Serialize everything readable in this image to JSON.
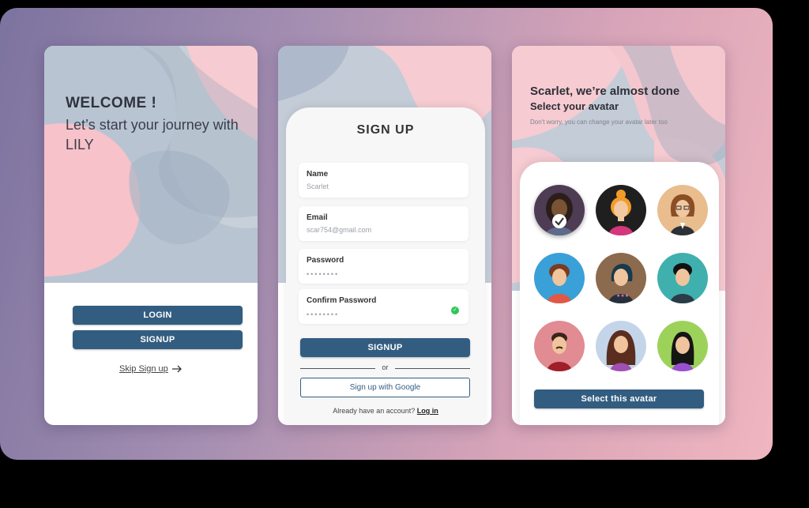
{
  "welcome_screen": {
    "title": "WELCOME !",
    "subtitle": "Let’s start your journey with LILY",
    "login_label": "LOGIN",
    "signup_label": "SIGNUP",
    "skip_label": "Skip Sign up",
    "skip_icon": "arrow-right-icon"
  },
  "signup_screen": {
    "title": "SIGN UP",
    "fields": [
      {
        "label": "Name",
        "value": "Scarlet"
      },
      {
        "label": "Email",
        "value": "scar754@gmail.com"
      },
      {
        "label": "Password",
        "value": "••••••••"
      },
      {
        "label": "Confirm Password",
        "value": "••••••••"
      }
    ],
    "signup_label": "SIGNUP",
    "or_label": "or",
    "google_label": "Sign up with Google",
    "have_account": "Already have an account?",
    "login_link": "Log in"
  },
  "avatar_screen": {
    "title": "Scarlet, we’re almost done",
    "subtitle": "Select your avatar",
    "note": "Don't worry, you can change your avatar later too",
    "select_label": "Select this avatar",
    "selected_index": 0
  },
  "colors": {
    "primary": "#335d80",
    "blob_pink": "#f5c4cc",
    "blob_blue": "#b7c3d1",
    "check_green": "#2ec55a"
  }
}
